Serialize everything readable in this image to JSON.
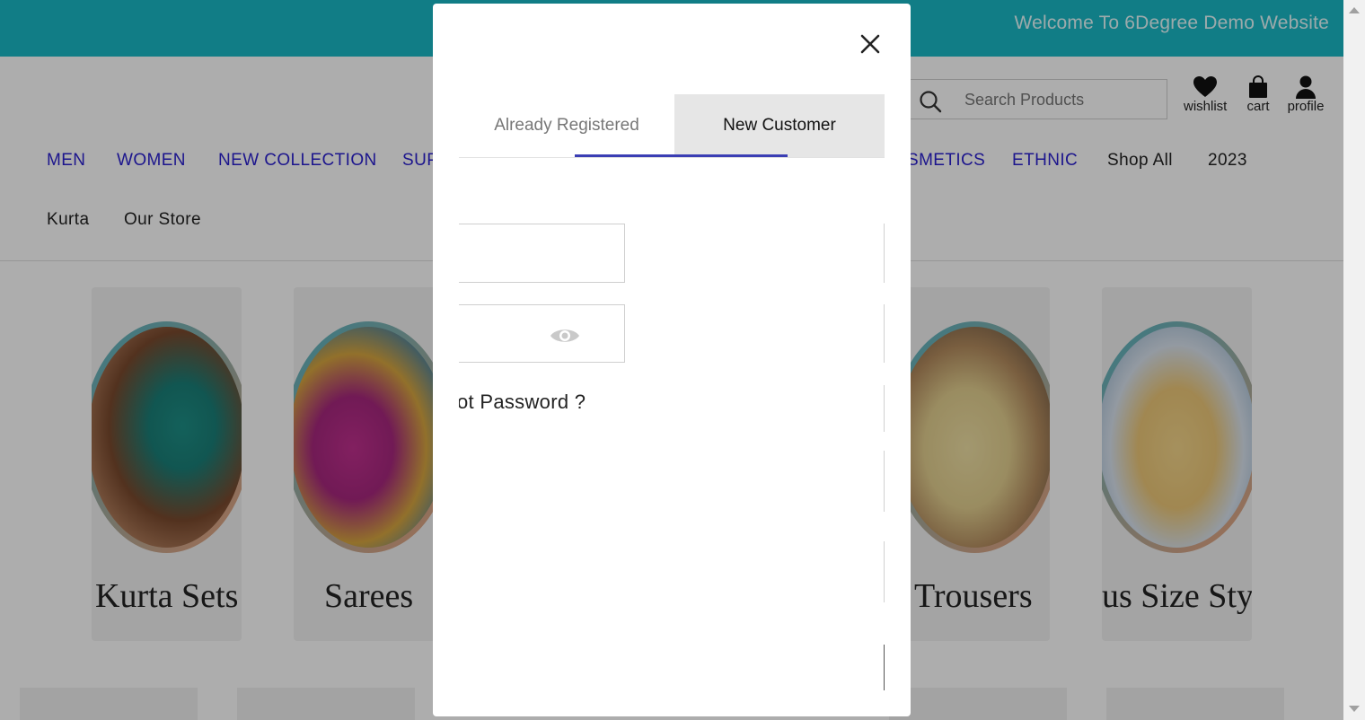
{
  "header": {
    "welcome_text": "Welcome To 6Degree Demo Website",
    "search_placeholder": "Search Products",
    "icons": [
      {
        "label": "wishlist",
        "icon": "heart-icon"
      },
      {
        "label": "cart",
        "icon": "shopping-bag-icon"
      },
      {
        "label": "profile",
        "icon": "user-icon"
      }
    ]
  },
  "nav": {
    "row1": [
      "MEN",
      "WOMEN",
      "NEW COLLECTION",
      "SUP",
      "SMETICS",
      "ETHNIC",
      "Shop All",
      "2023"
    ],
    "row2": [
      "Kurta",
      "Our Store"
    ]
  },
  "categories": [
    "Kurta Sets",
    "Sarees",
    "Trousers",
    "us Size Styl"
  ],
  "modal": {
    "tabs": [
      "Already Registered",
      "New Customer"
    ],
    "active_tab": "New Customer",
    "forgot_password": "ot Password ?",
    "colors": {
      "accent": "#3b3eb4",
      "active_tab_bg": "#e6e6e6"
    }
  },
  "colors": {
    "topbar": "#1ab8c6",
    "nav_link": "#2a1fd0"
  }
}
